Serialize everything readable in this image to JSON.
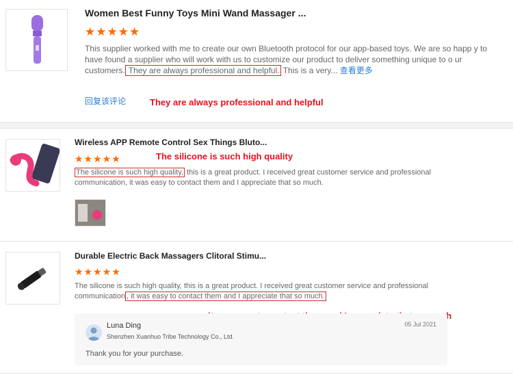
{
  "reviews": [
    {
      "title": "Women Best Funny Toys Mini Wand Massager ...",
      "stars": "★★★★★",
      "text_before": "This supplier worked with me to create our own Bluetooth protocol for our app-based toys. We are so happ y to have found a supplier who will work with us to customize our product to deliver something unique to o ur customers.",
      "text_highlight": " They are always professional and helpful.",
      "text_after": " This is a very... ",
      "see_more": "查看更多",
      "reply_link": "回复该评论",
      "annotation": "They are always professional and helpful"
    },
    {
      "title": "Wireless APP Remote Control Sex Things Bluto...",
      "stars": "★★★★★",
      "text_highlight": "The silicone is such high quality,",
      "text_after": " this is a great product. I received great customer service and professional communication, it was easy to contact them and I appreciate that so much.",
      "annotation": "The silicone is such high quality"
    },
    {
      "title": "Durable Electric Back Massagers Clitoral Stimu...",
      "stars": "★★★★★",
      "text_before": "The silicone is such high quality, this is a great product. I received great customer service and professional communication",
      "text_highlight": ", it was easy to contact them and I appreciate that so much.",
      "annotation": "it was easy to contact them and I appreciate that so much",
      "reply": {
        "name": "Luna Ding",
        "company": "Shenzhen Xuanhuo Tribe Technology Co., Ltd.",
        "date": "05 Jul 2021",
        "message": "Thank you for your purchase."
      }
    }
  ],
  "colors": {
    "accent": "#ff6a00",
    "annotation": "#e3131b",
    "link": "#2d7fd2"
  }
}
